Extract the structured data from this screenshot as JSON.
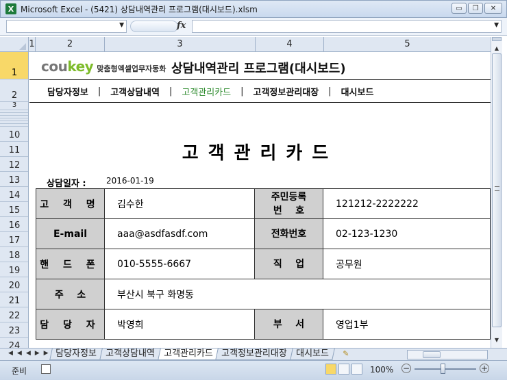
{
  "window": {
    "title": "Microsoft Excel - (5421) 상담내역관리 프로그램(대시보드).xlsm",
    "app_icon": "X",
    "minimize": "▭",
    "restore": "❐",
    "close": "✕"
  },
  "formula_bar": {
    "name_box": "",
    "fx": "fx",
    "formula": ""
  },
  "columns": [
    "1",
    "2",
    "3",
    "4",
    "5"
  ],
  "rows": [
    "1",
    "2",
    "3",
    "10",
    "11",
    "12",
    "13",
    "14",
    "15",
    "16",
    "17",
    "18",
    "19",
    "20",
    "21",
    "22",
    "23",
    "24"
  ],
  "brand": {
    "cou": "cou",
    "key": "key",
    "tagline": "맞춤형엑셀업무자동화"
  },
  "app_title": "상담내역관리 프로그램(대시보드)",
  "nav": {
    "items": [
      "담당자정보",
      "고객상담내역",
      "고객관리카드",
      "고객정보관리대장",
      "대시보드"
    ],
    "separator": "|"
  },
  "card": {
    "title": "고객관리카드",
    "date_label": "상담일자 :",
    "date_value": "2016-01-19",
    "rows": [
      {
        "label1": "고 객 명",
        "value1": "김수한",
        "label2a": "주민등록",
        "label2b": "번    호",
        "value2": "121212-2222222"
      },
      {
        "label1": "E-mail",
        "value1": "aaa@asdfasdf.com",
        "label2": "전화번호",
        "value2": "02-123-1230"
      },
      {
        "label1": "핸 드 폰",
        "value1": "010-5555-6667",
        "label2": "직    업",
        "value2": "공무원"
      },
      {
        "label1": "주    소",
        "value1": "부산시 북구 화명동"
      },
      {
        "label1": "담 당 자",
        "value1": "박영희",
        "label2": "부    서",
        "value2": "영업1부"
      }
    ]
  },
  "sheet_tabs": {
    "nav_arrows": "◀◀◀▶▶",
    "tabs": [
      "담당자정보",
      "고객상담내역",
      "고객관리카드",
      "고객정보관리대장",
      "대시보드"
    ],
    "active": "고객관리카드"
  },
  "status": {
    "ready": "준비",
    "zoom": "100%",
    "zoom_minus": "−",
    "zoom_plus": "+"
  }
}
